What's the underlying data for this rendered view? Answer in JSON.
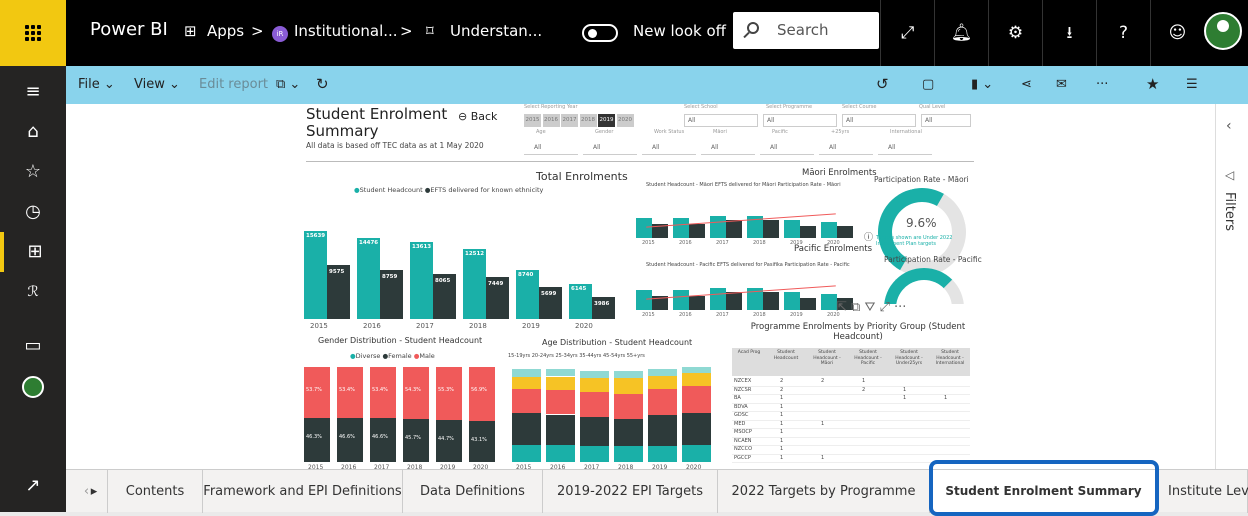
{
  "topbar": {
    "brand": "Power BI",
    "apps": "Apps",
    "sep1": ">",
    "workspace_badge": "iR",
    "workspace": "Institutional...",
    "sep2": ">",
    "report": "Understan...",
    "toggle_label": "New look off",
    "search_placeholder": "Search"
  },
  "toolbar": {
    "file": "File",
    "view": "View",
    "edit_report": "Edit report"
  },
  "report": {
    "title": "Student Enrolment Summary",
    "back": "Back",
    "subtitle": "All data is based off TEC data as at 1 May 2020",
    "slicers": {
      "year_label": "Select Reporting Year",
      "school_label": "Select School",
      "programme_label": "Select Programme",
      "course_label": "Select Course",
      "level_label": "Qual Level",
      "years": [
        "2015",
        "2016",
        "2017",
        "2018",
        "2019",
        "2020"
      ],
      "active_year": "2019",
      "age": "Age",
      "gender": "Gender",
      "work": "Work Status",
      "maori": "Māori",
      "pacific": "Pacific",
      "over25": "+25yrs",
      "international": "International",
      "all": "All"
    },
    "total": {
      "title": "Total Enrolments",
      "legend_a": "Student Headcount",
      "legend_b": "EFTS delivered for known ethnicity"
    },
    "maori": {
      "title": "Māori Enrolments",
      "legend": "Student Headcount - Māori  EFTS delivered for Māori  Participation Rate - Māori"
    },
    "pacific": {
      "title": "Pacific Enrolments",
      "legend": "Student Headcount - Pacific  EFTS delivered for Pasifika  Participation Rate - Pacific"
    },
    "part_maori": {
      "title": "Participation Rate - Māori",
      "value": "9.6%",
      "note": "Targets shown are Under 2022 Investment Plan targets"
    },
    "part_pacific": {
      "title": "Participation Rate - Pacific"
    },
    "gender": {
      "title": "Gender Distribution - Student Headcount",
      "legend_diverse": "Diverse",
      "legend_female": "Female",
      "legend_male": "Male"
    },
    "age": {
      "title": "Age Distribution - Student Headcount",
      "legend": "15-19yrs  20-24yrs  25-34yrs  35-44yrs  45-54yrs  55+yrs"
    },
    "prog": {
      "title": "Programme Enrolments by Priority Group (Student Headcount)",
      "headers": [
        "Acad Prog",
        "Student Headcount",
        "Student Headcount - Māori",
        "Student Headcount - Pacific",
        "Student Headcount - Under25yrs",
        "Student Headcount - International"
      ],
      "rows": [
        [
          "NZCEX",
          "2",
          "2",
          "1",
          ""
        ],
        [
          "NZCSR",
          "2",
          "",
          "2",
          "1"
        ],
        [
          "BA",
          "1",
          "",
          "",
          "1",
          "1"
        ],
        [
          "BDVA",
          "1",
          "",
          "",
          ""
        ],
        [
          "GDSC",
          "1",
          "",
          "",
          ""
        ],
        [
          "MED",
          "1",
          "1",
          "",
          ""
        ],
        [
          "MSOCP",
          "1",
          "",
          "",
          ""
        ],
        [
          "NCAEN",
          "1",
          "",
          "",
          ""
        ],
        [
          "NZCCO",
          "1",
          "",
          "",
          ""
        ],
        [
          "PGCCP",
          "1",
          "1",
          "",
          ""
        ]
      ]
    }
  },
  "tabs": [
    "Contents",
    "Framework and EPI Definitions",
    "Data Definitions",
    "2019-2022 EPI Targets",
    "2022 Targets by Programme",
    "Student Enrolment Summary",
    "Institute Leve"
  ],
  "filters_label": "Filters",
  "colors": {
    "teal": "#1ab0a8",
    "dark": "#2d3a3a",
    "red": "#f05a5a",
    "yellow": "#f6c325",
    "topbar": "#000000",
    "toolbar": "#89d3ec",
    "accent": "#f2c811",
    "highlight": "#1565c0"
  },
  "chart_data": [
    {
      "type": "bar",
      "title": "Total Enrolments",
      "categories": [
        "2015",
        "2016",
        "2017",
        "2018",
        "2019",
        "2020"
      ],
      "series": [
        {
          "name": "Student Headcount",
          "values": [
            15639,
            14476,
            13613,
            12512,
            8740,
            6145
          ]
        },
        {
          "name": "EFTS delivered for known ethnicity",
          "values": [
            9575,
            8759,
            8065,
            7449,
            5699,
            3986
          ]
        }
      ]
    },
    {
      "type": "bar",
      "title": "Gender Distribution - Student Headcount",
      "categories": [
        "2015",
        "2016",
        "2017",
        "2018",
        "2019",
        "2020"
      ],
      "series": [
        {
          "name": "Male",
          "values": [
            53.7,
            53.4,
            53.4,
            54.3,
            55.3,
            56.9
          ]
        },
        {
          "name": "Female",
          "values": [
            46.3,
            46.6,
            46.6,
            45.7,
            44.7,
            43.1
          ]
        }
      ]
    }
  ]
}
